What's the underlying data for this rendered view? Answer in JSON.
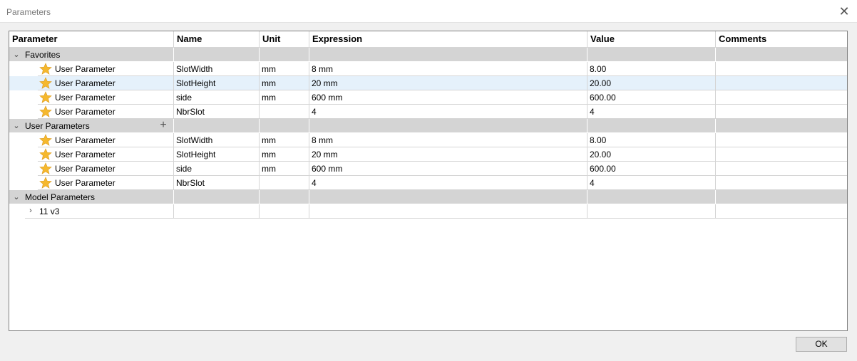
{
  "window": {
    "title": "Parameters"
  },
  "columns": [
    "Parameter",
    "Name",
    "Unit",
    "Expression",
    "Value",
    "Comments"
  ],
  "groups": [
    {
      "label": "Favorites",
      "rows": [
        {
          "type": "User Parameter",
          "name": "SlotWidth",
          "unit": "mm",
          "expression": "8 mm",
          "value": "8.00",
          "comments": ""
        },
        {
          "type": "User Parameter",
          "name": "SlotHeight",
          "unit": "mm",
          "expression": "20 mm",
          "value": "20.00",
          "comments": ""
        },
        {
          "type": "User Parameter",
          "name": "side",
          "unit": "mm",
          "expression": "600 mm",
          "value": "600.00",
          "comments": ""
        },
        {
          "type": "User Parameter",
          "name": "NbrSlot",
          "unit": "",
          "expression": "4",
          "value": "4",
          "comments": ""
        }
      ]
    },
    {
      "label": "User Parameters",
      "rows": [
        {
          "type": "User Parameter",
          "name": "SlotWidth",
          "unit": "mm",
          "expression": "8 mm",
          "value": "8.00",
          "comments": ""
        },
        {
          "type": "User Parameter",
          "name": "SlotHeight",
          "unit": "mm",
          "expression": "20 mm",
          "value": "20.00",
          "comments": ""
        },
        {
          "type": "User Parameter",
          "name": "side",
          "unit": "mm",
          "expression": "600 mm",
          "value": "600.00",
          "comments": ""
        },
        {
          "type": "User Parameter",
          "name": "NbrSlot",
          "unit": "",
          "expression": "4",
          "value": "4",
          "comments": ""
        }
      ]
    },
    {
      "label": "Model Parameters",
      "children": [
        {
          "label": "11 v3"
        }
      ]
    }
  ],
  "footer": {
    "ok_label": "OK"
  },
  "icons": {
    "star": "star-icon",
    "expand": "chevron-down-icon",
    "collapsed": "chevron-right-icon",
    "add": "plus-icon",
    "close": "close-icon"
  },
  "colors": {
    "group_bg": "#d4d4d4",
    "selected_row": "#e5f1fb",
    "star": "#f5b82e"
  }
}
